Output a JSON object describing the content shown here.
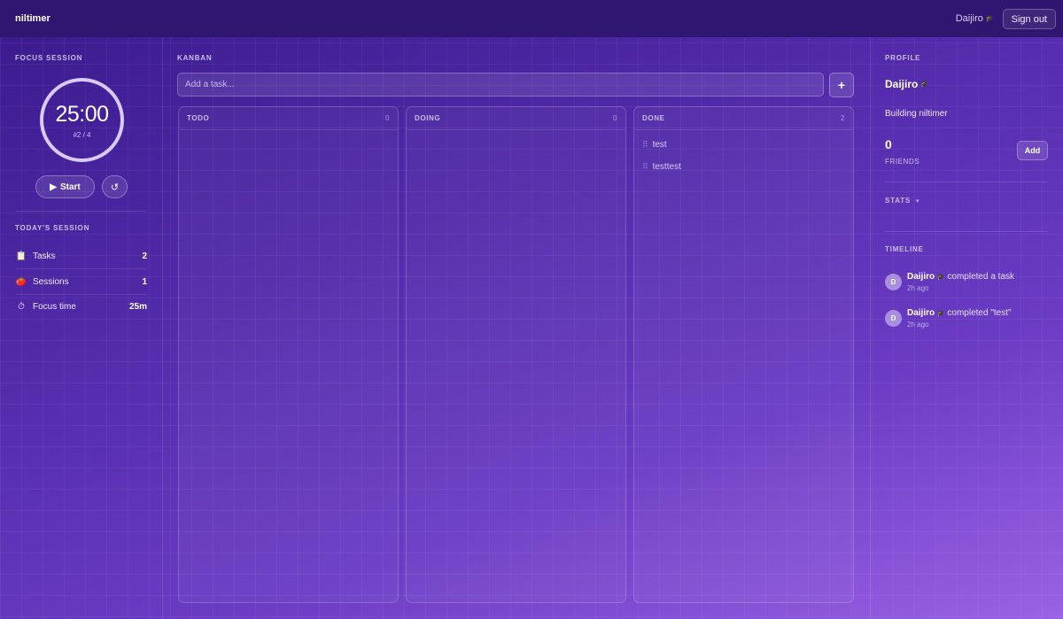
{
  "app": {
    "title": "niltimer"
  },
  "topbar": {
    "user": "Daijiro",
    "user_badge_icon": "grad-cap-icon",
    "signout_label": "Sign out"
  },
  "focus": {
    "title": "FOCUS SESSION",
    "time": "25:00",
    "count": "#2 / 4",
    "start_label": "Start",
    "play_icon": "play-icon",
    "reset_icon": "reset-icon"
  },
  "today": {
    "title": "TODAY'S SESSION",
    "rows": [
      {
        "icon": "clipboard-icon",
        "label": "Tasks",
        "value": "2"
      },
      {
        "icon": "tomato-icon",
        "label": "Sessions",
        "value": "1"
      },
      {
        "icon": "stopwatch-icon",
        "label": "Focus time",
        "value": "25m"
      }
    ]
  },
  "kanban": {
    "title": "KANBAN",
    "input_placeholder": "Add a task...",
    "add_label": "+",
    "columns": [
      {
        "title": "TODO",
        "count": "0",
        "cards": []
      },
      {
        "title": "DOING",
        "count": "0",
        "cards": []
      },
      {
        "title": "DONE",
        "count": "2",
        "cards": [
          "test",
          "testtest"
        ]
      }
    ]
  },
  "profile": {
    "title": "PROFILE",
    "name": "Daijiro",
    "status": "Building niltimer",
    "friends_count": "0",
    "friends_label": "FRIENDS",
    "add_label": "Add",
    "stats_label": "STATS",
    "timeline_title": "TIMELINE",
    "timeline": [
      {
        "avatar": "D",
        "user": "Daijiro",
        "action": "completed a task",
        "time": "2h ago"
      },
      {
        "avatar": "D",
        "user": "Daijiro",
        "action": "completed \"test\"",
        "time": "2h ago"
      }
    ]
  },
  "colors": {
    "accent": "#d9cbff",
    "topbar": "#2f1670",
    "bg_start": "#3a1a8c",
    "bg_end": "#9a62e4"
  }
}
